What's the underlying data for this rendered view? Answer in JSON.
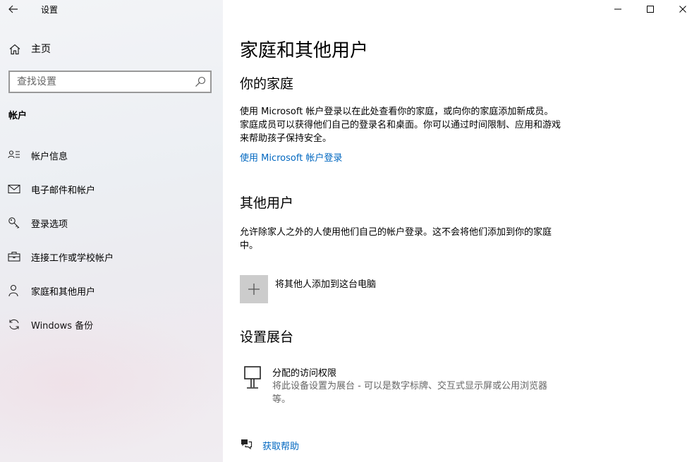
{
  "window": {
    "title": "设置",
    "controls": {
      "minimize_icon": "minimize-icon",
      "maximize_icon": "maximize-icon",
      "close_icon": "close-icon"
    }
  },
  "sidebar": {
    "home_label": "主页",
    "search_placeholder": "查找设置",
    "section_title": "帐户",
    "items": [
      {
        "label": "帐户信息",
        "icon": "account-info-icon"
      },
      {
        "label": "电子邮件和帐户",
        "icon": "mail-icon"
      },
      {
        "label": "登录选项",
        "icon": "key-icon"
      },
      {
        "label": "连接工作或学校帐户",
        "icon": "briefcase-icon"
      },
      {
        "label": "家庭和其他用户",
        "icon": "person-icon"
      },
      {
        "label": "Windows 备份",
        "icon": "sync-icon"
      }
    ]
  },
  "main": {
    "title": "家庭和其他用户",
    "family": {
      "heading": "你的家庭",
      "description": "使用 Microsoft 帐户登录以在此处查看你的家庭，或向你的家庭添加新成员。家庭成员可以获得他们自己的登录名和桌面。你可以通过时间限制、应用和游戏来帮助孩子保持安全。",
      "link": "使用 Microsoft 帐户登录"
    },
    "others": {
      "heading": "其他用户",
      "description": "允许除家人之外的人使用他们自己的帐户登录。这不会将他们添加到你的家庭中。",
      "add_label": "将其他人添加到这台电脑"
    },
    "kiosk": {
      "heading": "设置展台",
      "title": "分配的访问权限",
      "description": "将此设备设置为展台 - 可以是数字标牌、交互式显示屏或公用浏览器等。"
    },
    "help_link": "获取帮助"
  }
}
